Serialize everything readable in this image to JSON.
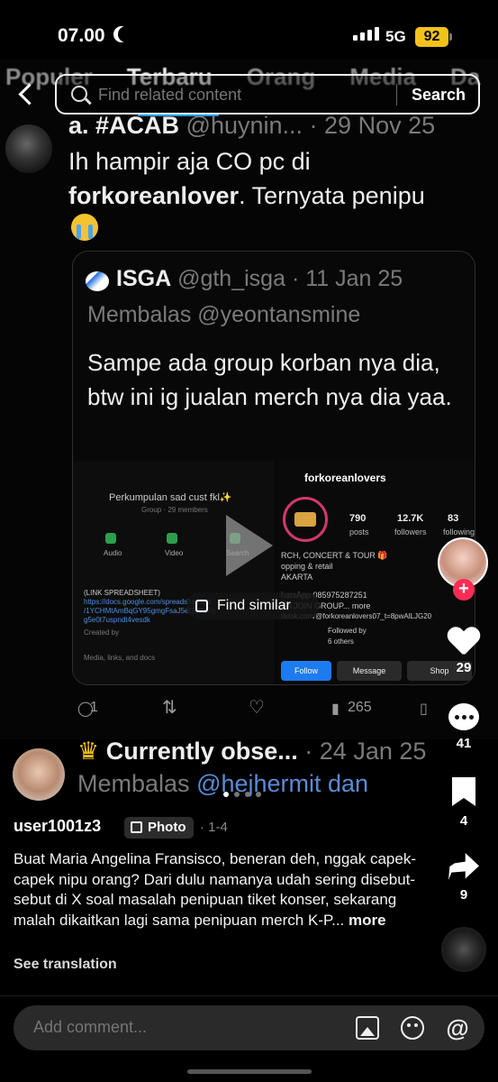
{
  "status_bar": {
    "time": "07.00",
    "network": "5G",
    "battery": "92"
  },
  "x_tabs": [
    "Populer",
    "Terbaru",
    "Orang",
    "Media",
    "Da"
  ],
  "search": {
    "placeholder": "Find related content",
    "button": "Search"
  },
  "tweet": {
    "name": "a. #ACAB",
    "handle": "@huynin...",
    "date": "· 29 Nov 25",
    "text_1": "Ih hampir aja CO pc di",
    "text_bold": "forkoreanlover",
    "text_2": ". Ternyata penipu",
    "quote": {
      "name": "ISGA",
      "handle": "@gth_isga",
      "date": "· 11 Jan 25",
      "reply": "Membalas @yeontansmine",
      "text": "Sampe ada group korban nya dia, btw ini ig jualan merch nya dia yaa.",
      "left_img": {
        "group_name": "Perkumpulan sad cust fkl✨",
        "group_meta": "Group · 29 members",
        "audio": "Audio",
        "video": "Video",
        "search": "Search",
        "link_title": "(LINK SPREADSHEET)",
        "link_1": "https://docs.google.com/spreadsheets/d",
        "link_2": "/1YCHMtAmBqGY95gmgFsaJ5eDLCd7rj",
        "link_3": "g5e0t7uspndt4vesdk",
        "created": "Created by",
        "media": "Media, links, and docs"
      },
      "right_img": {
        "username": "forkoreanlovers",
        "posts": "790",
        "posts_label": "posts",
        "followers": "12.7K",
        "followers_label": "followers",
        "following": "83",
        "following_label": "following",
        "bio_1": "RCH, CONCERT & TOUR 🎁",
        "bio_2": "opping & retail",
        "bio_3": "AKARTA",
        "bio_4": "hatsApp 085975287251",
        "bio_5": "SA JOIN GROUP... more",
        "bio_6": "tiktok.com/@forkoreanlovers07_t=8pwAlLJG20",
        "followed_by": "Followed by",
        "others": "6 others",
        "follow": "Follow",
        "message": "Message",
        "shop": "Shop"
      }
    },
    "find_similar": "Find similar",
    "actions": {
      "replies": "1",
      "views": "265"
    }
  },
  "rail": {
    "likes": "29",
    "comments": "41",
    "saves": "4",
    "shares": "9"
  },
  "preview_tweet": {
    "name": "Currently obse...",
    "date": "· 24 Jan 25",
    "reply_prefix": "Membalas",
    "reply_handle": "@hejhermit dan"
  },
  "post": {
    "username": "user1001z3",
    "type_badge": "Photo",
    "meta": "· 1-4",
    "caption": "Buat Maria Angelina Fransisco, beneran deh, nggak capek-capek nipu orang? Dari dulu namanya udah sering disebut-sebut di X soal masalah penipuan tiket konser, sekarang malah dikaitkan lagi sama penipuan merch K-P...",
    "more": "more",
    "translate": "See translation"
  },
  "comment": {
    "placeholder": "Add comment...",
    "at": "@"
  }
}
